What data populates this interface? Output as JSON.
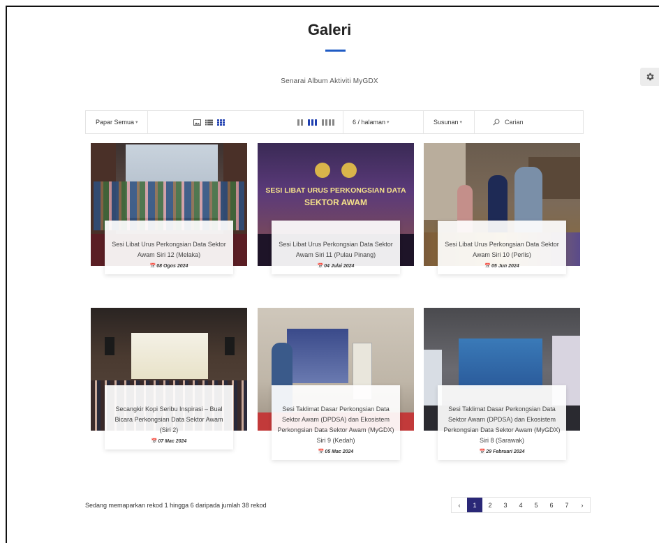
{
  "page": {
    "title": "Galeri",
    "subtitle": "Senarai Album Aktiviti MyGDX"
  },
  "toolbar": {
    "filter_label": "Papar Semua",
    "per_page_label": "6 / halaman",
    "sort_label": "Susunan",
    "search_placeholder": "Carian"
  },
  "albums": [
    {
      "title": "Sesi Libat Urus Perkongsian Data Sektor Awam Siri 12 (Melaka)",
      "date": "08 Ogos 2024"
    },
    {
      "title": "Sesi Libat Urus Perkongsian Data Sektor Awam Siri 11 (Pulau Pinang)",
      "date": "04 Julai 2024",
      "banner_line1": "SESI LIBAT URUS PERKONGSIAN DATA",
      "banner_line2": "SEKTOR AWAM"
    },
    {
      "title": "Sesi Libat Urus Perkongsian Data Sektor Awam Siri 10 (Perlis)",
      "date": "05 Jun 2024"
    },
    {
      "title": "Secangkir Kopi Seribu Inspirasi – Bual Bicara Perkongsian Data Sektor Awam (Siri 2)",
      "date": "07 Mac 2024"
    },
    {
      "title": "Sesi Taklimat Dasar Perkongsian Data Sektor Awam (DPDSA) dan Ekosistem Perkongsian Data Sektor Awam (MyGDX) Siri 9 (Kedah)",
      "date": "05 Mac 2024"
    },
    {
      "title": "Sesi Taklimat Dasar Perkongsian Data Sektor Awam (DPDSA) dan Ekosistem Perkongsian Data Sektor Awam (MyGDX) Siri 8 (Sarawak)",
      "date": "29 Februari 2024"
    }
  ],
  "footer": {
    "record_text": "Sedang memaparkan rekod 1 hingga 6 daripada jumlah 38 rekod"
  },
  "pagination": {
    "prev": "‹",
    "next": "›",
    "pages": [
      "1",
      "2",
      "3",
      "4",
      "5",
      "6",
      "7"
    ],
    "current": "1"
  },
  "colors": {
    "accent": "#1f5bc4",
    "active_page": "#2a2877"
  }
}
